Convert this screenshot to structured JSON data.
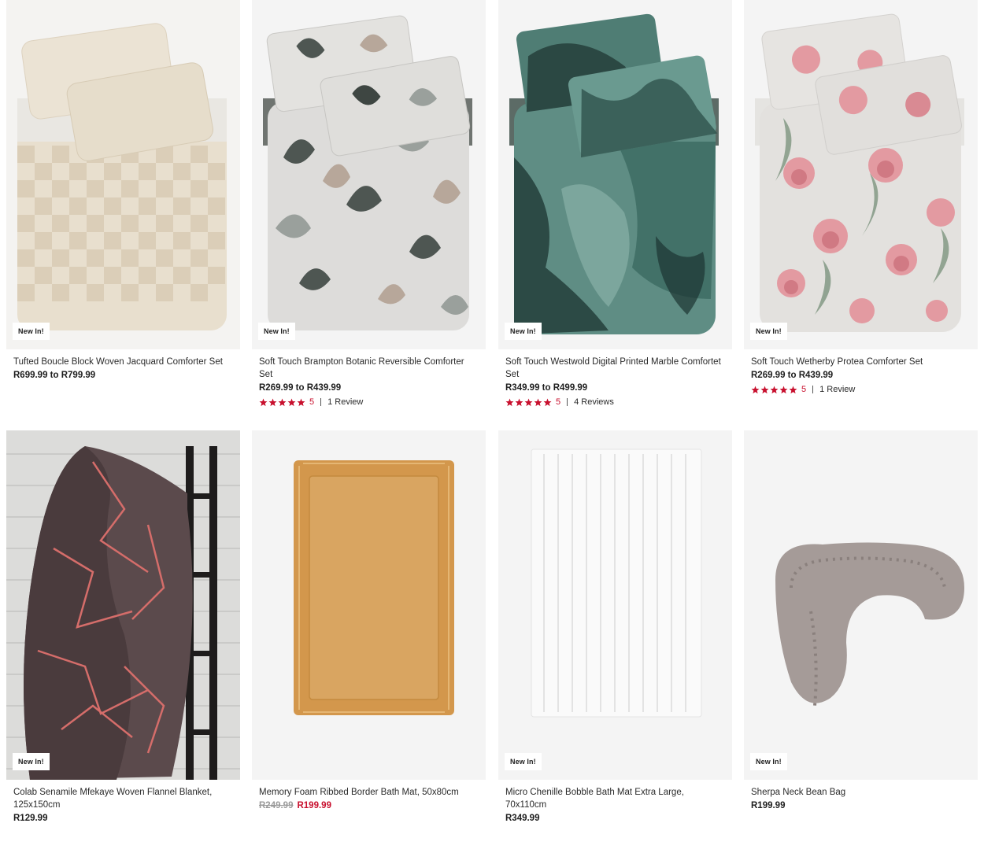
{
  "products": [
    {
      "title": "Tufted Boucle Block Woven Jacquard Comforter Set",
      "badge": "New In!",
      "price": "R699.99 to R799.99",
      "old_price": "",
      "sale_price": "",
      "rating": "",
      "reviews": "",
      "image": "beige-check-comforter",
      "colors": {
        "bg": "#f4f3f1",
        "main": "#e6dccb",
        "alt": "#d8cab2"
      }
    },
    {
      "title": "Soft Touch Brampton Botanic Reversible Comforter Set",
      "badge": "New In!",
      "price": "R269.99 to R439.99",
      "old_price": "",
      "sale_price": "",
      "rating": "5",
      "reviews": "1 Review",
      "image": "botanic-leaf-comforter",
      "colors": {
        "bg": "#f4f4f4",
        "main": "#d9d9d7",
        "alt": "#555b57"
      }
    },
    {
      "title": "Soft Touch Westwold Digital Printed Marble Comfortet Set",
      "badge": "New In!",
      "price": "R349.99 to R499.99",
      "old_price": "",
      "sale_price": "",
      "rating": "5",
      "reviews": "4 Reviews",
      "image": "green-marble-comforter",
      "colors": {
        "bg": "#f4f4f4",
        "main": "#5f8f86",
        "alt": "#1f3b37"
      }
    },
    {
      "title": "Soft Touch Wetherby Protea Comforter Set",
      "badge": "New In!",
      "price": "R269.99 to R439.99",
      "old_price": "",
      "sale_price": "",
      "rating": "5",
      "reviews": "1 Review",
      "image": "protea-floral-comforter",
      "colors": {
        "bg": "#f4f4f4",
        "main": "#e4e2df",
        "alt": "#d98a93"
      }
    },
    {
      "title": "Colab Senamile Mfekaye Woven Flannel Blanket, 125x150cm",
      "badge": "New In!",
      "price": "R129.99",
      "old_price": "",
      "sale_price": "",
      "rating": "",
      "reviews": "",
      "image": "flannel-blanket-ladder",
      "colors": {
        "bg": "#d8d8d6",
        "main": "#5b4a4c",
        "alt": "#d56d6a"
      }
    },
    {
      "title": "Memory Foam Ribbed Border Bath Mat, 50x80cm",
      "badge": "",
      "price": "",
      "old_price": "R249.99",
      "sale_price": "R199.99",
      "rating": "",
      "reviews": "",
      "image": "mustard-bath-mat",
      "colors": {
        "bg": "#f4f4f4",
        "main": "#d9a561",
        "alt": "#c99143"
      }
    },
    {
      "title": "Micro Chenille Bobble Bath Mat Extra Large, 70x110cm",
      "badge": "New In!",
      "price": "R349.99",
      "old_price": "",
      "sale_price": "",
      "rating": "",
      "reviews": "",
      "image": "white-bobble-bath-mat",
      "colors": {
        "bg": "#f4f4f4",
        "main": "#fbfbfb",
        "alt": "#e3e3e3"
      }
    },
    {
      "title": "Sherpa Neck Bean Bag",
      "badge": "New In!",
      "price": "R199.99",
      "old_price": "",
      "sale_price": "",
      "rating": "",
      "reviews": "",
      "image": "grey-sherpa-neck-pillow",
      "colors": {
        "bg": "#f4f4f4",
        "main": "#a59b98",
        "alt": "#8a807d"
      }
    }
  ],
  "accent_color": "#c8102e"
}
